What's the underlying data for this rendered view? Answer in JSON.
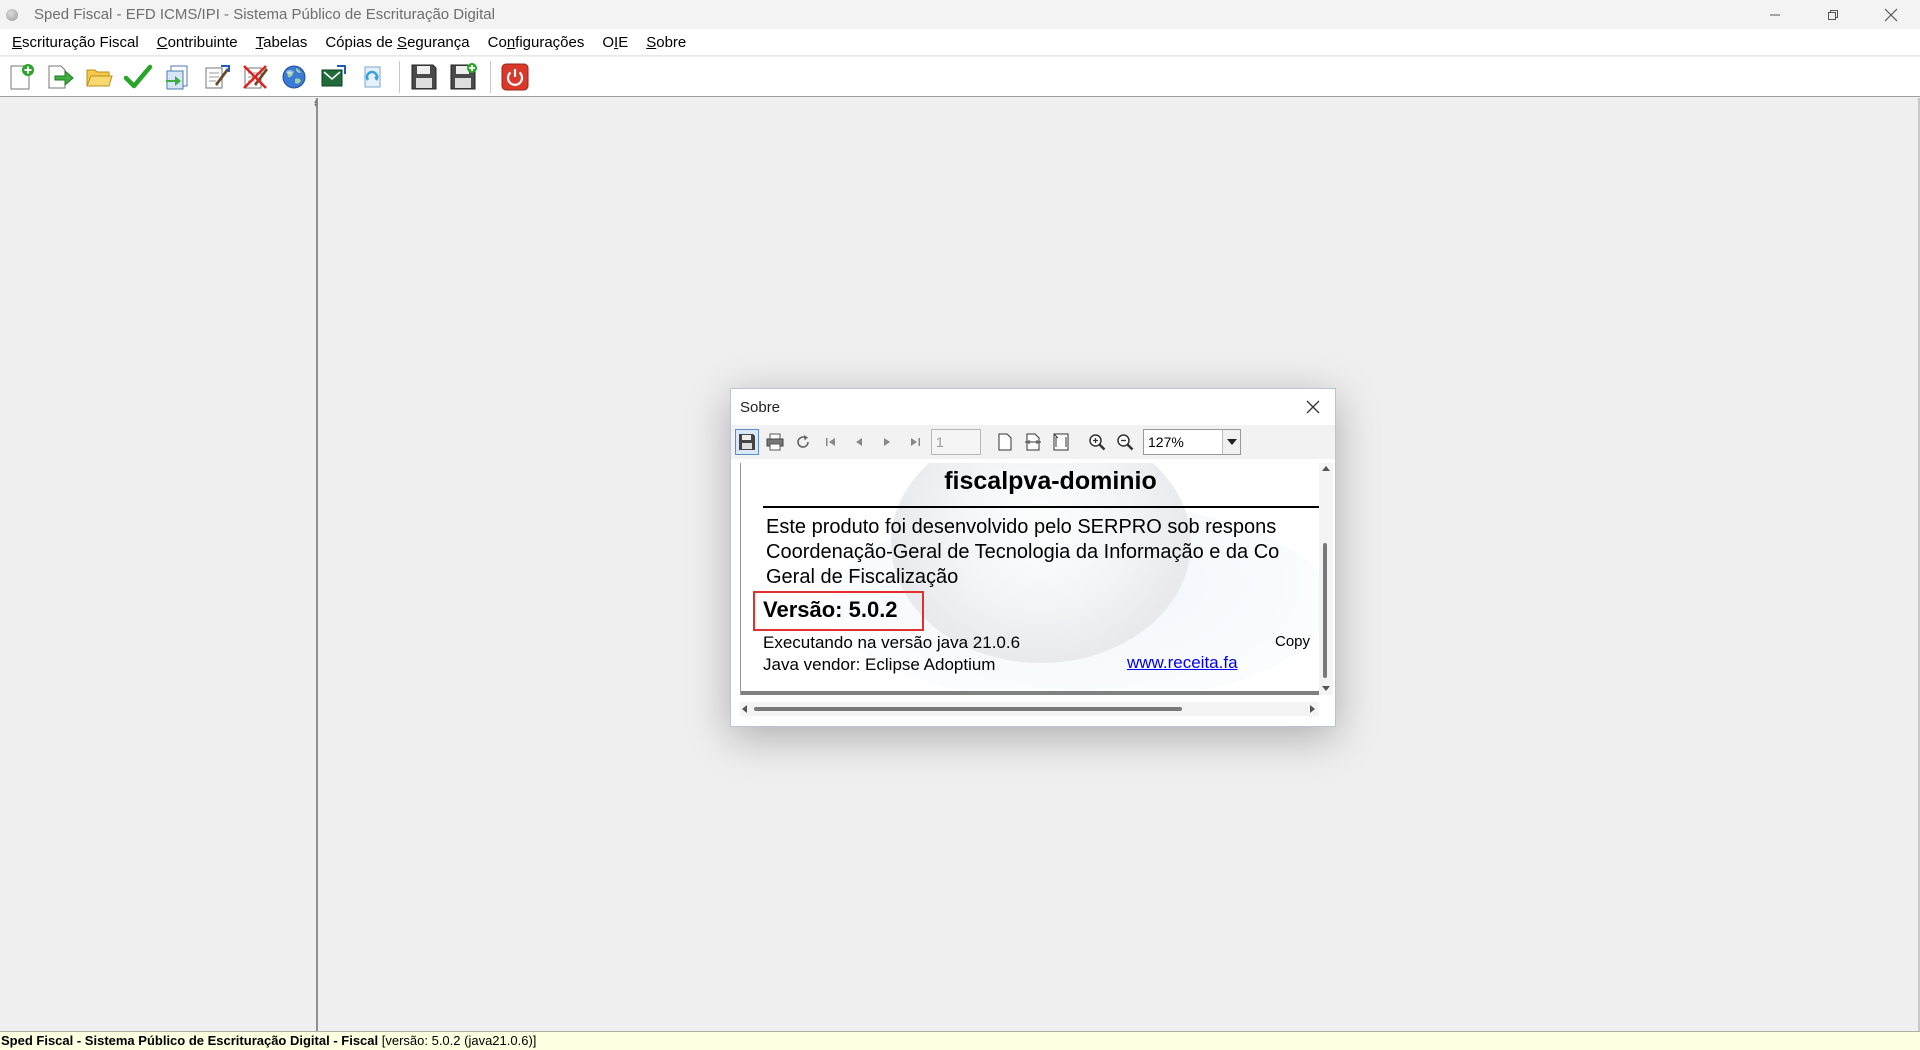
{
  "window": {
    "title": "Sped Fiscal - EFD ICMS/IPI - Sistema Público de Escrituração Digital"
  },
  "menu": {
    "items": [
      {
        "first": "E",
        "rest": "scrituração Fiscal"
      },
      {
        "first": "C",
        "rest": "ontribuinte"
      },
      {
        "first": "T",
        "rest": "abelas"
      },
      {
        "first": "Cópias de ",
        "u": "S",
        "rest": "egurança"
      },
      {
        "first": "Co",
        "u": "n",
        "rest": "figurações"
      },
      {
        "first": "O",
        "u": "I",
        "rest": "E"
      },
      {
        "first": "S",
        "rest": "obre"
      }
    ]
  },
  "toolbar": {
    "icons": [
      "new-file-icon",
      "import-arrow-icon",
      "open-folder-icon",
      "validate-check-icon",
      "export-icon",
      "sign-icon",
      "remove-sign-icon",
      "globe-icon",
      "transmit-icon",
      "recycle-icon",
      "save-copy-icon",
      "restore-copy-icon",
      "power-icon"
    ]
  },
  "dialog": {
    "title": "Sobre",
    "pdf_toolbar": {
      "page_value": "1",
      "zoom_value": "127%"
    },
    "document": {
      "title": "fiscalpva-dominio",
      "desc_line1": "Este produto foi desenvolvido pelo SERPRO sob respons",
      "desc_line2": "Coordenação-Geral de Tecnologia da Informação e da Co",
      "desc_line3": "Geral de Fiscalização",
      "version": "Versão: 5.0.2",
      "java_version": "Executando na versão java  21.0.6",
      "java_vendor": "Java vendor: Eclipse Adoptium",
      "copyright": "Copy",
      "link": "www.receita.fa"
    }
  },
  "statusbar": {
    "bold_text": "Sped Fiscal - Sistema Público de Escrituração Digital - Fiscal",
    "normal_text": " [versão: 5.0.2 (java21.0.6)]"
  },
  "colors": {
    "status_bg": "#ffffe1",
    "highlight_box": "#e03030",
    "link": "#0000ee"
  }
}
